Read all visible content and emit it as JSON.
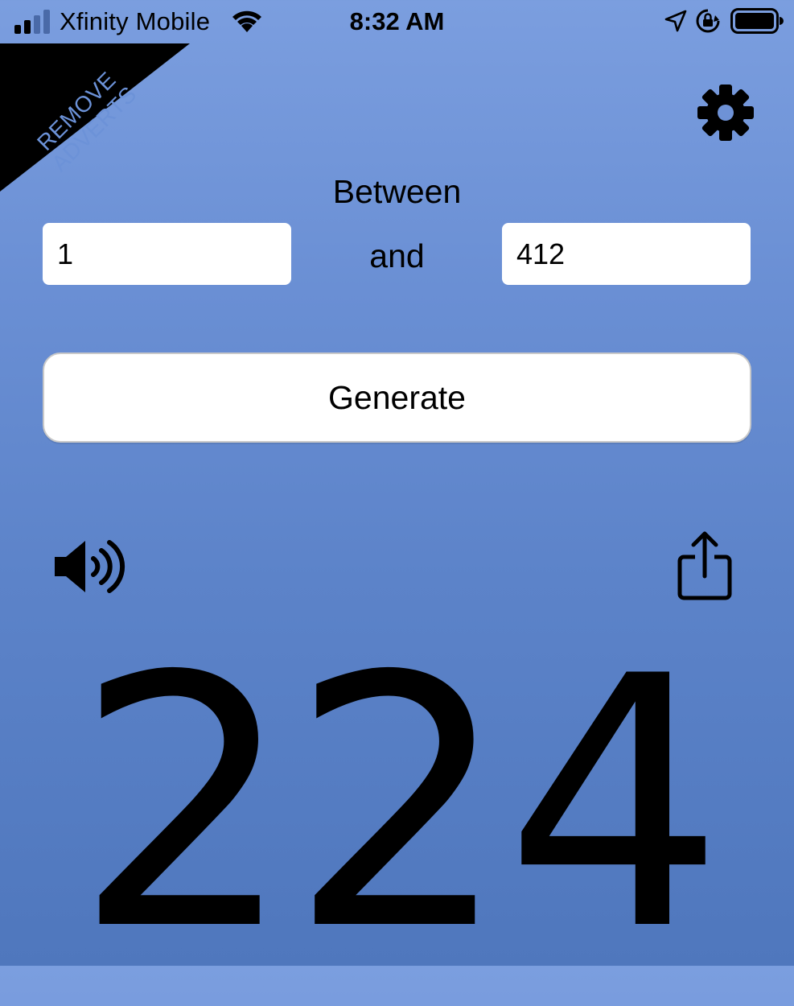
{
  "status_bar": {
    "carrier": "Xfinity Mobile",
    "time": "8:32 AM",
    "icons": [
      "cellular-signal-icon",
      "wifi-icon",
      "location-arrow-icon",
      "rotation-lock-icon",
      "battery-icon"
    ]
  },
  "promo": {
    "line1": "REMOVE",
    "line2": "ADVERTS"
  },
  "settings": {
    "icon": "gear-icon"
  },
  "range": {
    "between_label": "Between",
    "and_label": "and",
    "min_value": "1",
    "max_value": "412"
  },
  "generate": {
    "label": "Generate"
  },
  "actions": {
    "sound_icon": "speaker-icon",
    "share_icon": "share-icon"
  },
  "result": {
    "value": "224"
  },
  "colors": {
    "background_top": "#7b9edf",
    "background_bottom": "#4f77bd",
    "banner": "#000000",
    "banner_text": "#6c92d8",
    "field": "#ffffff"
  }
}
